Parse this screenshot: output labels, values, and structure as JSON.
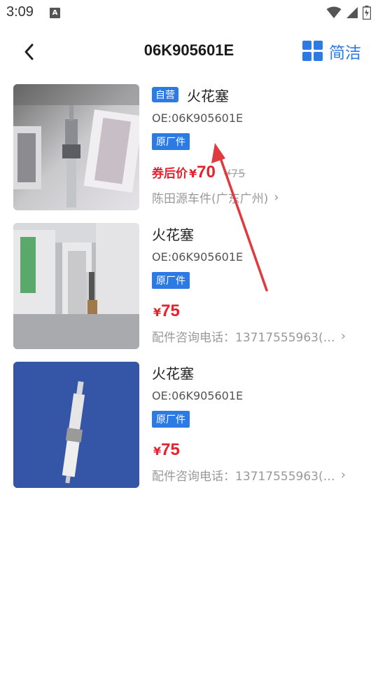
{
  "status_bar": {
    "time": "3:09",
    "notif_icon_letter": "A"
  },
  "header": {
    "title": "06K905601E",
    "view_toggle_label": "简洁"
  },
  "products": [
    {
      "self_badge": "自营",
      "name": "火花塞",
      "oe": "OE:06K905601E",
      "oem_badge": "原厂件",
      "coupon_label": "券后价",
      "currency": "¥",
      "price": "70",
      "original_price": "¥75",
      "seller": "陈田源车件(广东广州)"
    },
    {
      "name": "火花塞",
      "oe": "OE:06K905601E",
      "oem_badge": "原厂件",
      "currency": "¥",
      "price": "75",
      "seller": "配件咨询电话：13717555963(北..."
    },
    {
      "name": "火花塞",
      "oe": "OE:06K905601E",
      "oem_badge": "原厂件",
      "currency": "¥",
      "price": "75",
      "seller": "配件咨询电话：13717555963(北..."
    }
  ],
  "colors": {
    "accent": "#2c7be5",
    "price": "#e5212b",
    "arrow": "#e0393e"
  }
}
